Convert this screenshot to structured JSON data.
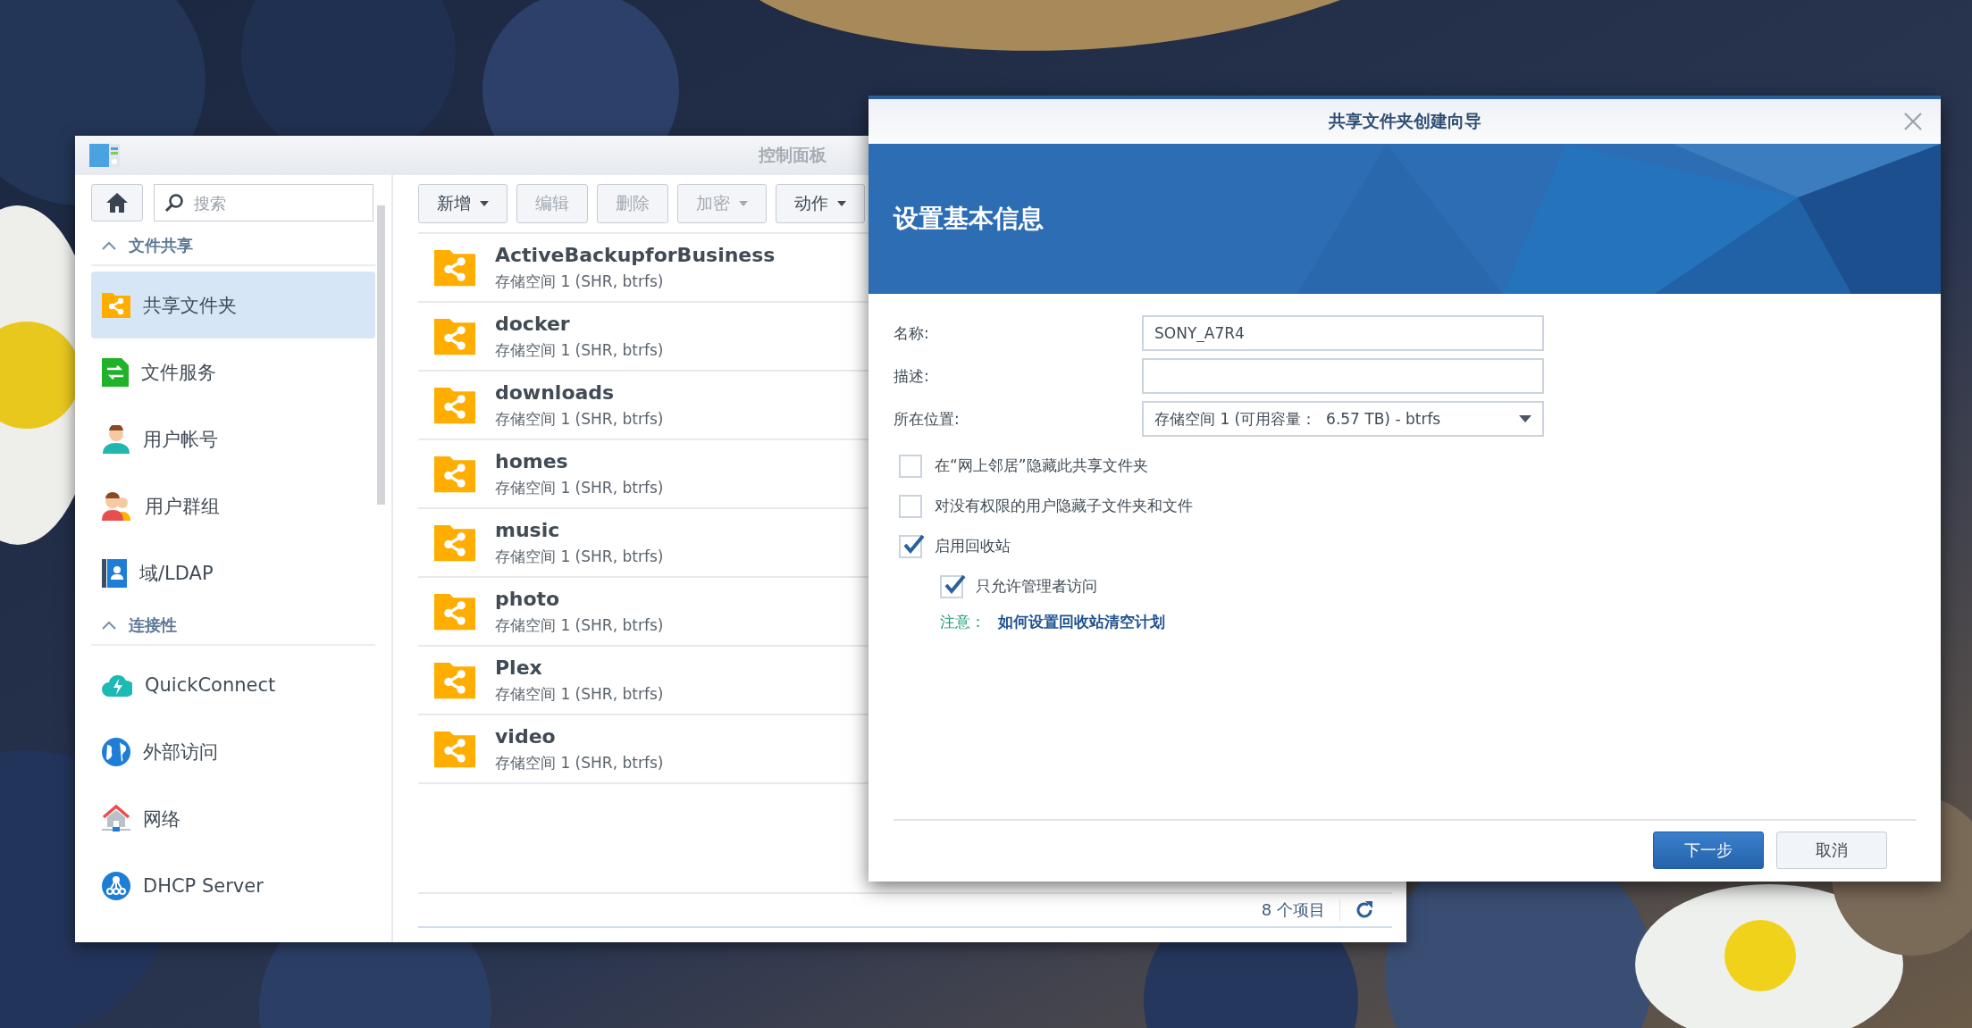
{
  "control_panel": {
    "title": "控制面板",
    "search": {
      "placeholder": "搜索"
    },
    "sidebar": [
      {
        "label": "文件共享",
        "expanded": true,
        "items": [
          {
            "label": "共享文件夹",
            "selected": true
          },
          {
            "label": "文件服务",
            "selected": false
          },
          {
            "label": "用户帐号",
            "selected": false
          },
          {
            "label": "用户群组",
            "selected": false
          },
          {
            "label": "域/LDAP",
            "selected": false
          }
        ]
      },
      {
        "label": "连接性",
        "expanded": true,
        "items": [
          {
            "label": "QuickConnect",
            "selected": false
          },
          {
            "label": "外部访问",
            "selected": false
          },
          {
            "label": "网络",
            "selected": false
          },
          {
            "label": "DHCP Server",
            "selected": false
          }
        ]
      }
    ],
    "toolbar": [
      {
        "label": "新增",
        "dropdown": true,
        "disabled": false
      },
      {
        "label": "编辑",
        "dropdown": false,
        "disabled": true
      },
      {
        "label": "删除",
        "dropdown": false,
        "disabled": true
      },
      {
        "label": "加密",
        "dropdown": true,
        "disabled": true
      },
      {
        "label": "动作",
        "dropdown": true,
        "disabled": false
      }
    ],
    "folders": [
      {
        "name": "ActiveBackupforBusiness",
        "location": "存储空间 1 (SHR, btrfs)"
      },
      {
        "name": "docker",
        "location": "存储空间 1 (SHR, btrfs)"
      },
      {
        "name": "downloads",
        "location": "存储空间 1 (SHR, btrfs)"
      },
      {
        "name": "homes",
        "location": "存储空间 1 (SHR, btrfs)"
      },
      {
        "name": "music",
        "location": "存储空间 1 (SHR, btrfs)"
      },
      {
        "name": "photo",
        "location": "存储空间 1 (SHR, btrfs)"
      },
      {
        "name": "Plex",
        "location": "存储空间 1 (SHR, btrfs)"
      },
      {
        "name": "video",
        "location": "存储空间 1 (SHR, btrfs)"
      }
    ],
    "status": "8 个项目"
  },
  "wizard": {
    "title": "共享文件夹创建向导",
    "heading": "设置基本信息",
    "fields": [
      {
        "label": "名称:",
        "kind": "text",
        "value": "SONY_A7R4"
      },
      {
        "label": "描述:",
        "kind": "text"
      },
      {
        "label": "所在位置:",
        "kind": "select",
        "value": "存储空间 1 (可用容量：  6.57 TB) - btrfs"
      }
    ],
    "options": [
      {
        "label": "在“网上邻居”隐藏此共享文件夹",
        "checked": false
      },
      {
        "label": "对没有权限的用户隐藏子文件夹和文件",
        "checked": false
      },
      {
        "label": "启用回收站",
        "checked": true,
        "children": [
          {
            "label": "只允许管理者访问",
            "checked": true
          }
        ]
      }
    ],
    "note": {
      "label": "注意：",
      "link": "如何设置回收站清空计划"
    },
    "buttons": [
      {
        "label": "下一步",
        "primary": true
      },
      {
        "label": "取消",
        "primary": false
      }
    ]
  }
}
